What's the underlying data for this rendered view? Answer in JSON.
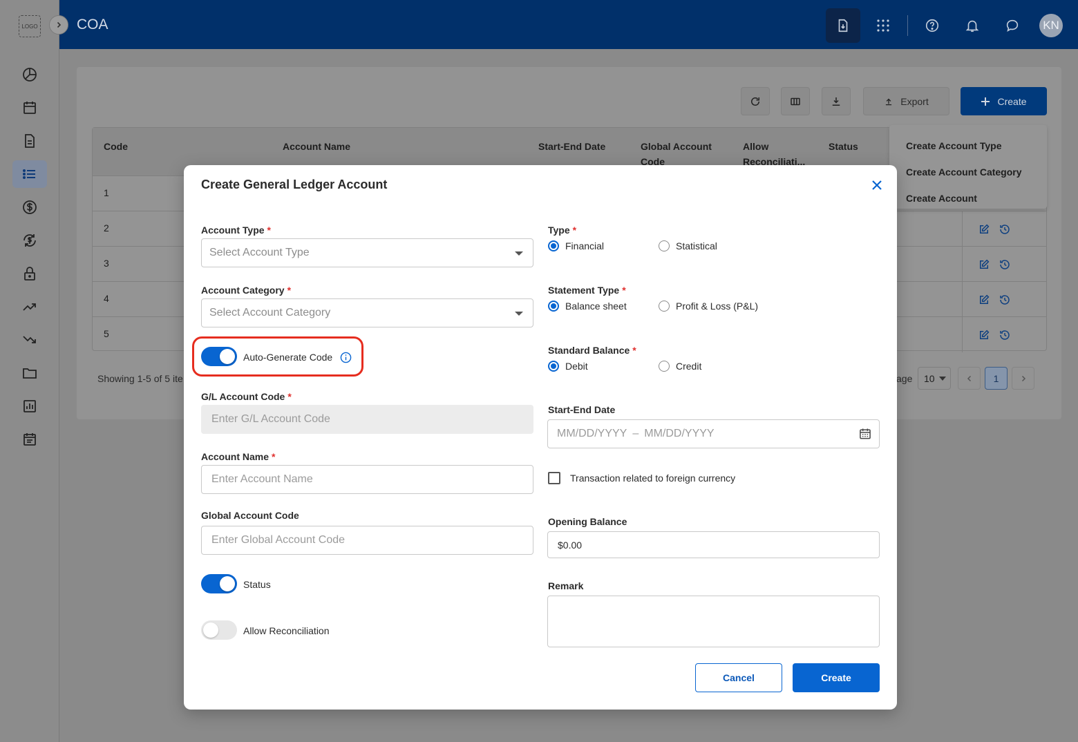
{
  "app": {
    "logo_text": "LOGO",
    "page_title": "COA",
    "avatar_initials": "KN"
  },
  "sidebar": {
    "items": [
      {
        "icon": "pie-chart-icon",
        "active": false
      },
      {
        "icon": "calendar-icon",
        "active": false
      },
      {
        "icon": "document-icon",
        "active": false
      },
      {
        "icon": "list-icon",
        "active": true
      },
      {
        "icon": "dollar-icon",
        "active": false
      },
      {
        "icon": "currency-exchange-icon",
        "active": false
      },
      {
        "icon": "lock-icon",
        "active": false
      },
      {
        "icon": "trending-up-icon",
        "active": false
      },
      {
        "icon": "trending-down-icon",
        "active": false
      },
      {
        "icon": "folder-icon",
        "active": false
      },
      {
        "icon": "bar-chart-icon",
        "active": false
      },
      {
        "icon": "schedule-icon",
        "active": false
      }
    ]
  },
  "toolbar": {
    "export_label": "Export",
    "create_label": "Create"
  },
  "table": {
    "headers": {
      "code": "Code",
      "account_name": "Account Name",
      "start_end_date": "Start-End Date",
      "global_account_code_line1": "Global Account",
      "global_account_code_line2": "Code",
      "allow_reconciliation_line1": "Allow",
      "allow_reconciliation_line2": "Reconciliati...",
      "status": "Status"
    },
    "rows": [
      {
        "code": "1"
      },
      {
        "code": "2"
      },
      {
        "code": "3"
      },
      {
        "code": "4"
      },
      {
        "code": "5"
      }
    ],
    "showing_text": "Showing 1-5 of 5 ite",
    "per_page_label": "age",
    "page_size": "10",
    "current_page": "1"
  },
  "create_menu": {
    "items": [
      "Create Account Type",
      "Create Account Category",
      "Create Account"
    ]
  },
  "modal": {
    "title": "Create General Ledger Account",
    "account_type": {
      "label": "Account Type",
      "placeholder": "Select Account Type"
    },
    "account_category": {
      "label": "Account Category",
      "placeholder": "Select Account Category"
    },
    "auto_generate": {
      "label": "Auto-Generate Code",
      "on": true
    },
    "gl_code": {
      "label": "G/L Account Code",
      "placeholder": "Enter G/L Account Code"
    },
    "account_name": {
      "label": "Account Name",
      "placeholder": "Enter Account Name"
    },
    "global_code": {
      "label": "Global Account Code",
      "placeholder": "Enter Global Account Code"
    },
    "status": {
      "label": "Status",
      "on": true
    },
    "allow_reconciliation": {
      "label": "Allow Reconciliation",
      "on": false
    },
    "type": {
      "label": "Type",
      "options": [
        "Financial",
        "Statistical"
      ],
      "selected": "Financial"
    },
    "statement_type": {
      "label": "Statement Type",
      "options": [
        "Balance sheet",
        "Profit & Loss (P&L)"
      ],
      "selected": "Balance sheet"
    },
    "standard_balance": {
      "label": "Standard Balance",
      "options": [
        "Debit",
        "Credit"
      ],
      "selected": "Debit"
    },
    "start_end_date": {
      "label": "Start-End Date",
      "start_placeholder": "MM/DD/YYYY",
      "separator": "–",
      "end_placeholder": "MM/DD/YYYY"
    },
    "foreign_currency": {
      "label": "Transaction related to foreign currency",
      "checked": false
    },
    "opening_balance": {
      "label": "Opening Balance",
      "value": "$0.00"
    },
    "remark": {
      "label": "Remark",
      "value": ""
    },
    "cancel_label": "Cancel",
    "create_label": "Create"
  },
  "colors": {
    "primary": "#0865d1",
    "topbar": "#01306a",
    "required": "#e0312f",
    "highlight": "#e62d1f"
  }
}
